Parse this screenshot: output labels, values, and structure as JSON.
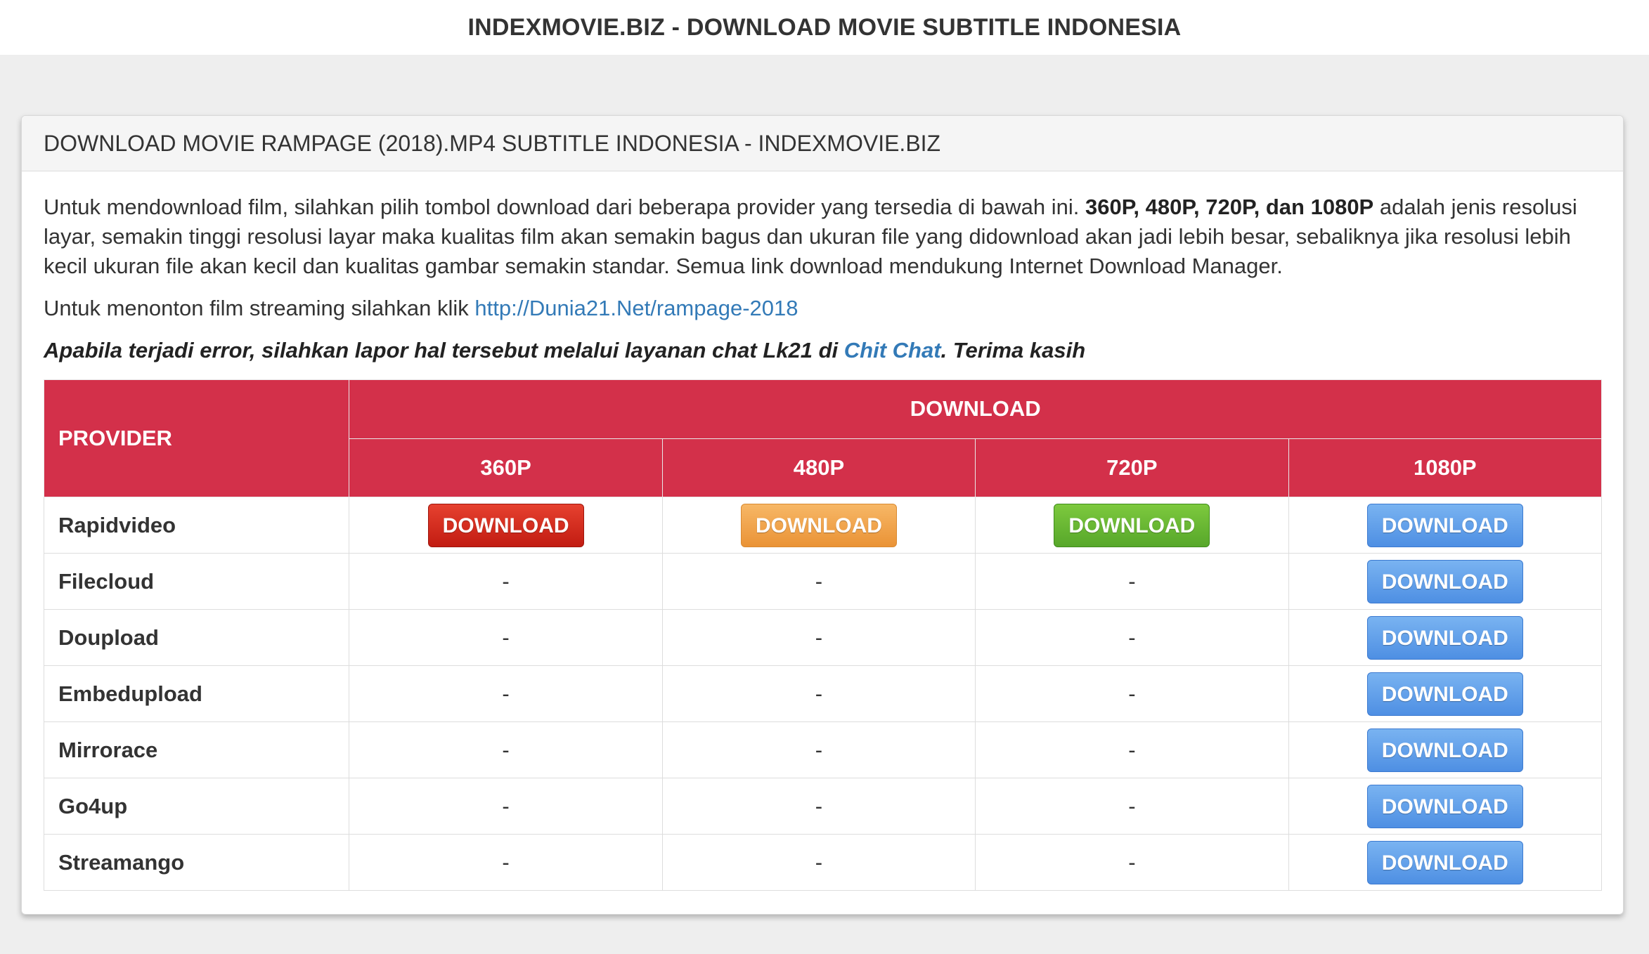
{
  "header": {
    "title": "INDEXMOVIE.BIZ - DOWNLOAD MOVIE SUBTITLE INDONESIA"
  },
  "panel": {
    "heading": "DOWNLOAD MOVIE RAMPAGE (2018).MP4 SUBTITLE INDONESIA - INDEXMOVIE.BIZ",
    "intro_part1": "Untuk mendownload film, silahkan pilih tombol download dari beberapa provider yang tersedia di bawah ini. ",
    "intro_bold": "360P, 480P, 720P, dan 1080P",
    "intro_part2": " adalah jenis resolusi layar, semakin tinggi resolusi layar maka kualitas film akan semakin bagus dan ukuran file yang didownload akan jadi lebih besar, sebaliknya jika resolusi lebih kecil ukuran file akan kecil dan kualitas gambar semakin standar. Semua link download mendukung Internet Download Manager.",
    "stream_text": "Untuk menonton film streaming silahkan klik ",
    "stream_link": "http://Dunia21.Net/rampage-2018",
    "notice_text": "Apabila terjadi error, silahkan lapor hal tersebut melalui layanan chat Lk21 di ",
    "notice_link": "Chit Chat",
    "notice_end": ". Terima kasih"
  },
  "table": {
    "provider_header": "PROVIDER",
    "download_header": "DOWNLOAD",
    "resolutions": [
      "360P",
      "480P",
      "720P",
      "1080P"
    ],
    "button_label": "DOWNLOAD",
    "empty_cell": "-",
    "rows": [
      {
        "provider": "Rapidvideo"
      },
      {
        "provider": "Filecloud"
      },
      {
        "provider": "Doupload"
      },
      {
        "provider": "Embedupload"
      },
      {
        "provider": "Mirrorace"
      },
      {
        "provider": "Go4up"
      },
      {
        "provider": "Streamango"
      }
    ]
  },
  "colors": {
    "table_header": "#d3304a",
    "btn_360": "#d42a1e",
    "btn_480": "#f0a44c",
    "btn_720": "#6bb834",
    "btn_1080": "#5f9ee9",
    "link": "#337ab7"
  }
}
